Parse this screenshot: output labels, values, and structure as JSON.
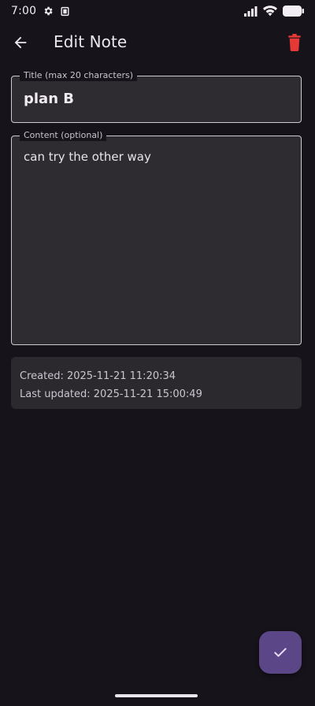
{
  "status_bar": {
    "time": "7:00"
  },
  "app_bar": {
    "title": "Edit Note"
  },
  "title_field": {
    "label": "Title (max 20 characters)",
    "value": "plan B"
  },
  "content_field": {
    "label": "Content (optional)",
    "value": "can try the other way"
  },
  "meta": {
    "created": "Created: 2025-11-21 11:20:34",
    "updated": "Last updated: 2025-11-21 15:00:49"
  },
  "colors": {
    "background": "#16131a",
    "field_fill": "#2e2c30",
    "delete_red": "#e53935",
    "fab": "#5b4788"
  },
  "icons": {
    "back": "arrow-back-icon",
    "delete": "trash-icon",
    "save": "check-icon"
  }
}
